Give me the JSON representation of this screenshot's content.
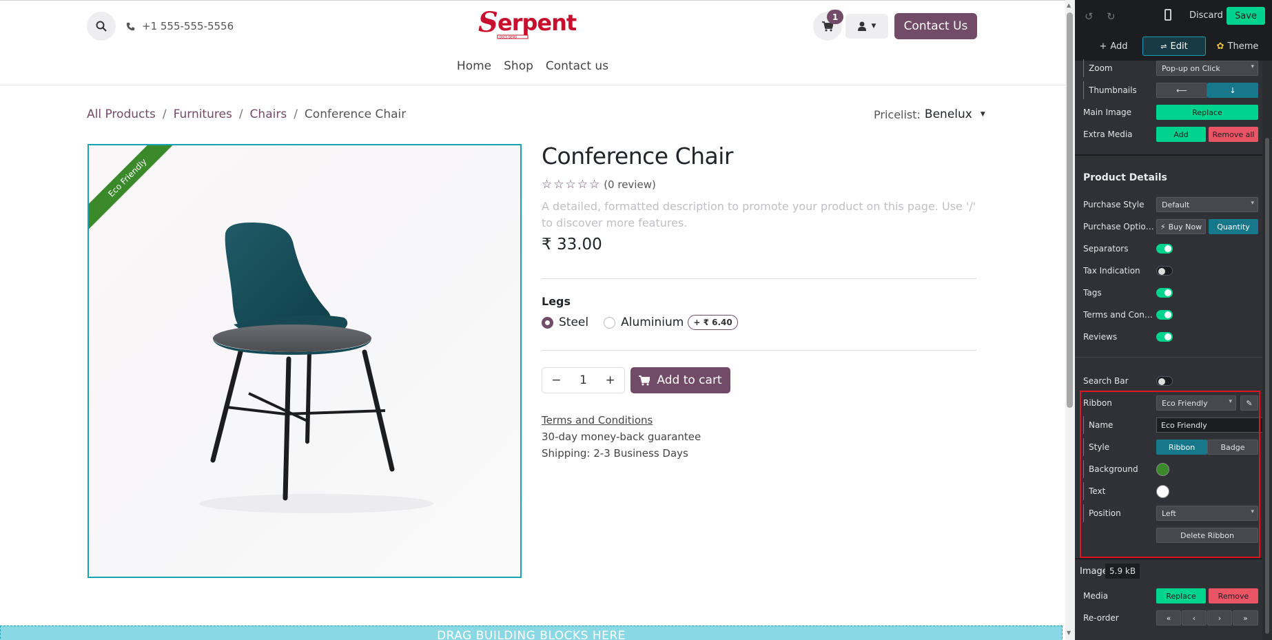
{
  "header": {
    "phone": "+1 555-555-5556",
    "logo_text": "Serpent",
    "logo_tagline": "DOCS DEMO",
    "cart_count": "1",
    "contact_button": "Contact Us",
    "nav": [
      "Home",
      "Shop",
      "Contact us"
    ]
  },
  "breadcrumb": {
    "items": [
      "All Products",
      "Furnitures",
      "Chairs"
    ],
    "current": "Conference Chair",
    "separator": "/"
  },
  "pricelist": {
    "label": "Pricelist:",
    "value": "Benelux"
  },
  "product": {
    "ribbon": "Eco Friendly",
    "title": "Conference Chair",
    "stars": "☆☆☆☆☆",
    "review_count": "(0 review)",
    "description_placeholder": "A detailed, formatted description to promote your product on this page. Use '/' to discover more features.",
    "price": "₹ 33.00",
    "attribute_label": "Legs",
    "variants": [
      {
        "name": "Steel",
        "selected": true,
        "extra": ""
      },
      {
        "name": "Aluminium",
        "selected": false,
        "extra": "+ ₹ 6.40"
      }
    ],
    "quantity": "1",
    "add_to_cart": "Add to cart",
    "terms_link": "Terms and Conditions",
    "guarantee": "30-day money-back guarantee",
    "shipping": "Shipping: 2-3 Business Days"
  },
  "dropzone_text": "DRAG BUILDING BLOCKS HERE",
  "editor": {
    "discard": "Discard",
    "save": "Save",
    "tabs": {
      "add": "Add",
      "edit": "Edit",
      "theme": "Theme"
    },
    "image_options": {
      "zoom_label": "Zoom",
      "zoom_value": "Pop-up on Click",
      "thumbnails_label": "Thumbnails",
      "thumbnails_left": "⟵",
      "thumbnails_bottom": "↓",
      "main_image_label": "Main Image",
      "main_image_button": "Replace",
      "extra_media_label": "Extra Media",
      "extra_media_add": "Add",
      "extra_media_remove": "Remove all"
    },
    "product_details": {
      "title": "Product Details",
      "purchase_style_label": "Purchase Style",
      "purchase_style_value": "Default",
      "purchase_options_label": "Purchase Options",
      "buy_now": "Buy Now",
      "quantity": "Quantity",
      "toggles": [
        {
          "label": "Separators",
          "on": true
        },
        {
          "label": "Tax Indication",
          "on": false
        },
        {
          "label": "Tags",
          "on": true
        },
        {
          "label": "Terms and Conditi...",
          "on": true
        },
        {
          "label": "Reviews",
          "on": true
        }
      ]
    },
    "search_bar": {
      "label": "Search Bar",
      "on": false
    },
    "ribbon": {
      "label": "Ribbon",
      "value": "Eco Friendly",
      "name_label": "Name",
      "name_value": "Eco Friendly",
      "style_label": "Style",
      "style_ribbon": "Ribbon",
      "style_badge": "Badge",
      "background_label": "Background",
      "background_color": "#3a8a2c",
      "text_label": "Text",
      "text_color": "#ffffff",
      "position_label": "Position",
      "position_value": "Left",
      "delete_button": "Delete Ribbon"
    },
    "image": {
      "label": "Image",
      "size": "5.9 kB",
      "media_label": "Media",
      "replace": "Replace",
      "remove": "Remove",
      "reorder_label": "Re-order",
      "reorder_buttons": [
        "«",
        "‹",
        "›",
        "»"
      ]
    }
  },
  "colors": {
    "brand": "#714b67",
    "accent_cyan": "#17a2b8",
    "editor_green": "#00d38d",
    "editor_red": "#ea5565",
    "logo_red": "#c8102e"
  }
}
